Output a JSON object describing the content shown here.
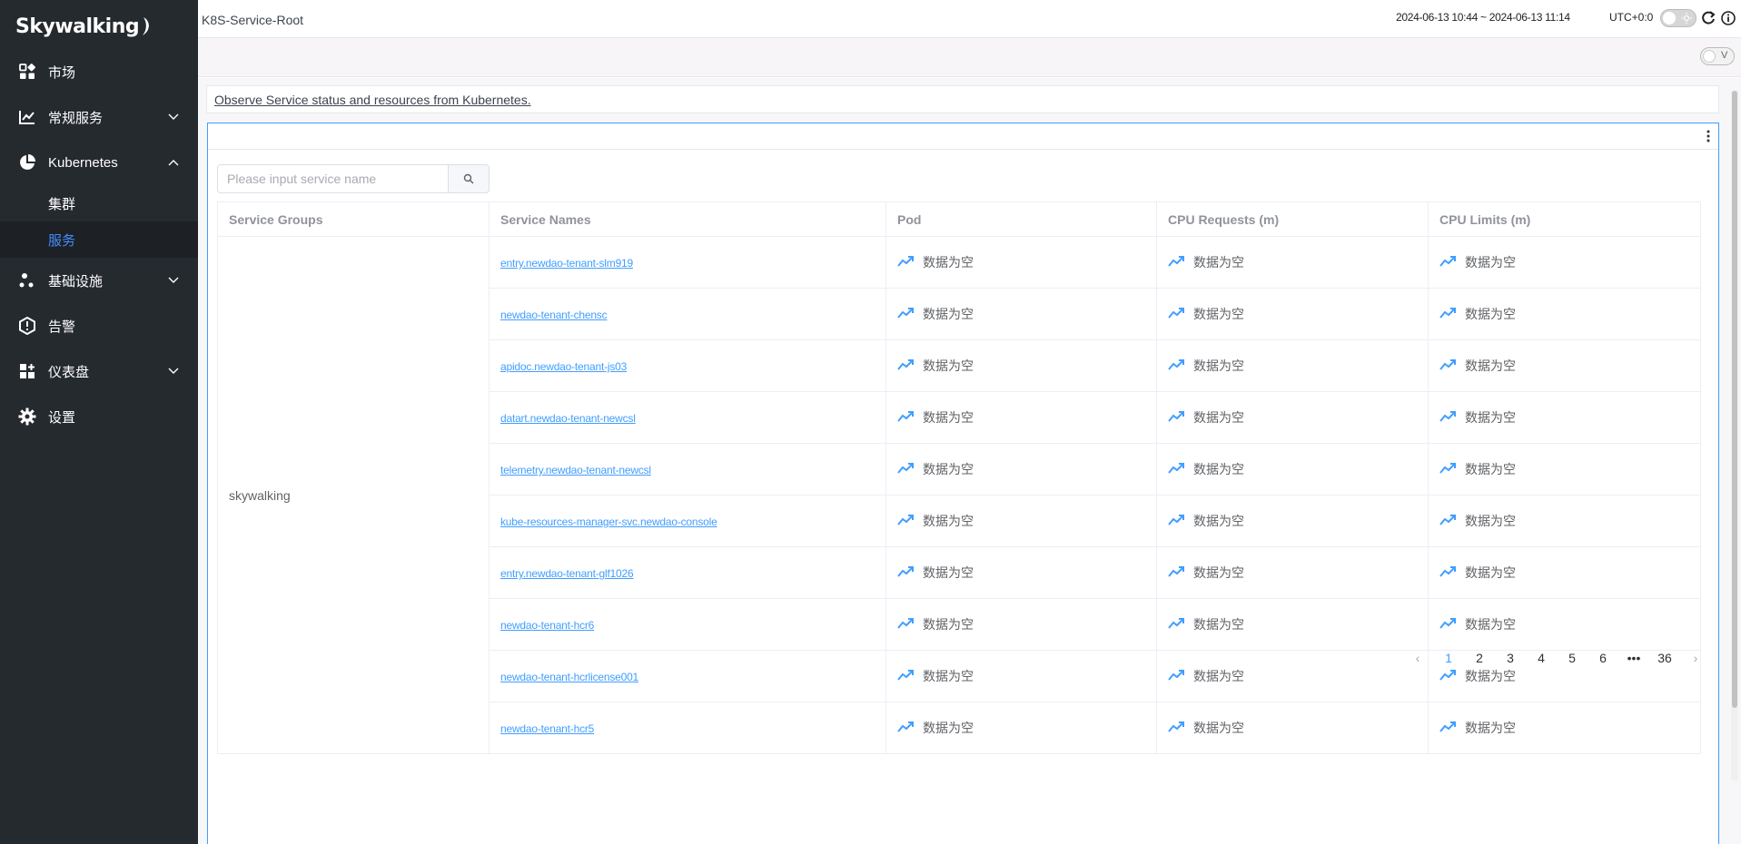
{
  "app": {
    "logo_text": "Skywalking"
  },
  "sidebar": {
    "items": [
      {
        "label": "市场",
        "icon": "marketplace-icon"
      },
      {
        "label": "常规服务",
        "icon": "chart-icon"
      },
      {
        "label": "Kubernetes",
        "icon": "pie-icon"
      },
      {
        "label": "基础设施",
        "icon": "infra-icon"
      },
      {
        "label": "告警",
        "icon": "alarm-icon"
      },
      {
        "label": "仪表盘",
        "icon": "dashboard-icon"
      },
      {
        "label": "设置",
        "icon": "gear-icon"
      }
    ],
    "k8s_sub": [
      {
        "label": "集群"
      },
      {
        "label": "服务"
      }
    ]
  },
  "header": {
    "title": "K8S-Service-Root",
    "time_range": "2024-06-13 10:44 ~ 2024-06-13 11:14",
    "utc": "UTC+0:0",
    "v_switch": "V"
  },
  "main": {
    "description": "Observe Service status and resources from Kubernetes.",
    "search_placeholder": "Please input service name",
    "columns": [
      "Service Groups",
      "Service Names",
      "Pod",
      "CPU Requests (m)",
      "CPU Limits (m)"
    ],
    "group": "skywalking",
    "empty_text": "数据为空",
    "rows": [
      {
        "name": "entry.newdao-tenant-slm919"
      },
      {
        "name": "newdao-tenant-chensc"
      },
      {
        "name": "apidoc.newdao-tenant-js03"
      },
      {
        "name": "datart.newdao-tenant-newcsl"
      },
      {
        "name": "telemetry.newdao-tenant-newcsl"
      },
      {
        "name": "kube-resources-manager-svc.newdao-console"
      },
      {
        "name": "entry.newdao-tenant-glf1026"
      },
      {
        "name": "newdao-tenant-hcr6"
      },
      {
        "name": "newdao-tenant-hcrlicense001"
      },
      {
        "name": "newdao-tenant-hcr5"
      }
    ],
    "pagination": {
      "pages": [
        "1",
        "2",
        "3",
        "4",
        "5",
        "6"
      ],
      "ellipsis": "•••",
      "last": "36",
      "current": "1"
    }
  },
  "colors": {
    "sidebar_bg": "#252a2f",
    "accent": "#409eff",
    "active_menu": "#448dfe"
  }
}
